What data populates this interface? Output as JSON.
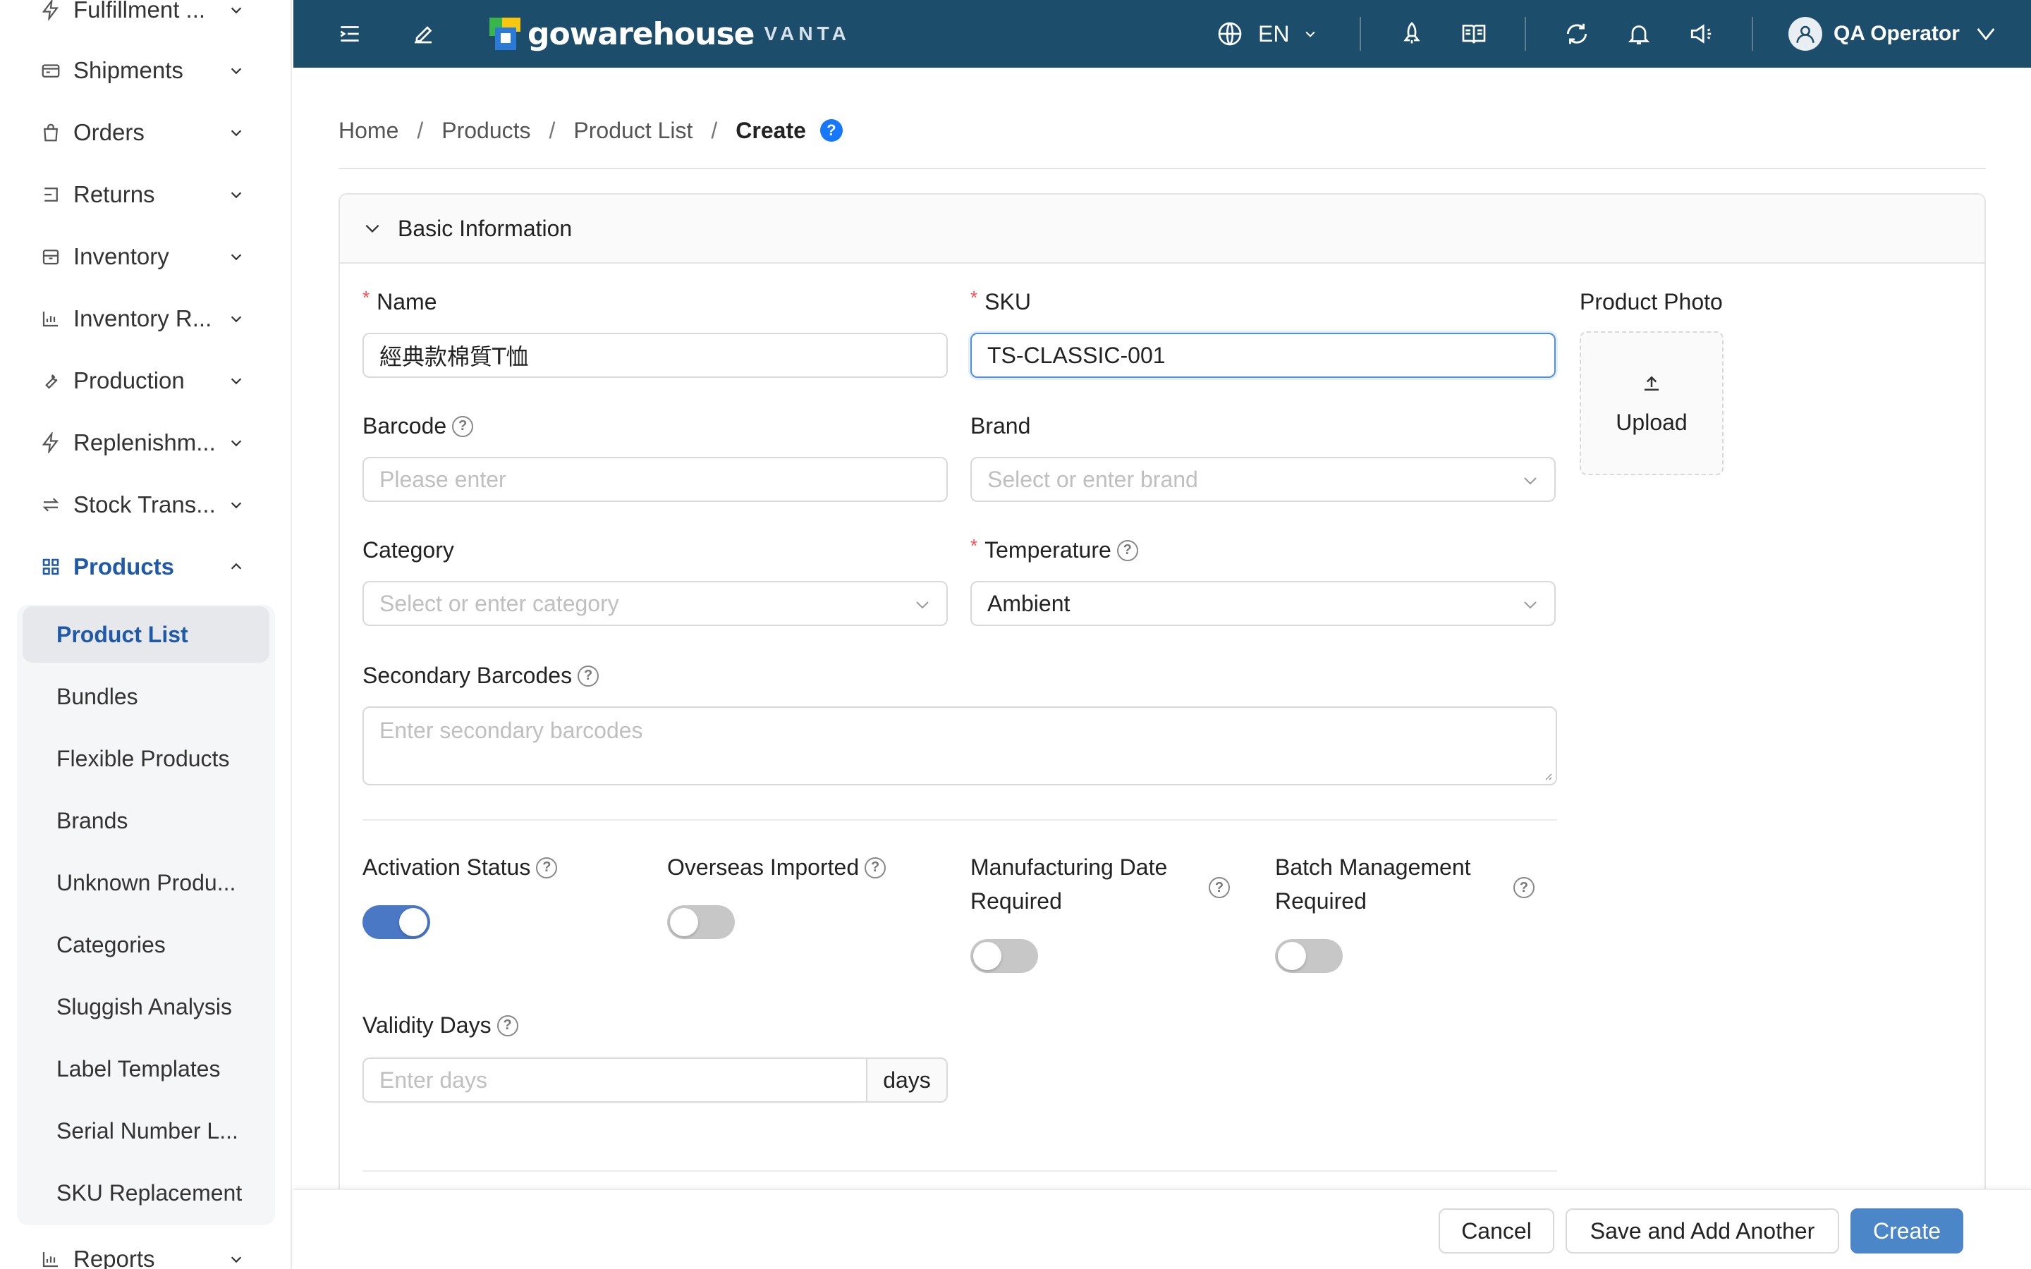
{
  "sidebar": {
    "items": [
      {
        "label": "Fulfillment ...",
        "icon": "bolt-icon"
      },
      {
        "label": "Shipments",
        "icon": "truck-icon"
      },
      {
        "label": "Orders",
        "icon": "bag-icon"
      },
      {
        "label": "Returns",
        "icon": "return-icon"
      },
      {
        "label": "Inventory",
        "icon": "box-icon"
      },
      {
        "label": "Inventory R...",
        "icon": "bar-chart-icon"
      },
      {
        "label": "Production",
        "icon": "wrench-icon"
      },
      {
        "label": "Replenishm...",
        "icon": "bolt-icon"
      },
      {
        "label": "Stock Trans...",
        "icon": "transfer-icon"
      },
      {
        "label": "Products",
        "icon": "grid-icon"
      },
      {
        "label": "Reports",
        "icon": "bar-chart-icon"
      }
    ],
    "submenu": [
      "Product List",
      "Bundles",
      "Flexible Products",
      "Brands",
      "Unknown Produ...",
      "Categories",
      "Sluggish Analysis",
      "Label Templates",
      "Serial Number L...",
      "SKU Replacement"
    ]
  },
  "header": {
    "brand": "gowarehouse",
    "brand_sub": "VANTA",
    "lang": "EN",
    "user": "QA Operator",
    "colors": {
      "bar": "#1c4d6b"
    }
  },
  "breadcrumb": {
    "items": [
      "Home",
      "Products",
      "Product List"
    ],
    "current": "Create",
    "help": "?"
  },
  "section": {
    "title": "Basic Information"
  },
  "form": {
    "name": {
      "label": "Name",
      "value": "經典款棉質T恤"
    },
    "sku": {
      "label": "SKU",
      "value": "TS-CLASSIC-001"
    },
    "photo": {
      "label": "Product Photo",
      "upload": "Upload"
    },
    "barcode": {
      "label": "Barcode",
      "placeholder": "Please enter"
    },
    "brand": {
      "label": "Brand",
      "placeholder": "Select or enter brand"
    },
    "category": {
      "label": "Category",
      "placeholder": "Select or enter category"
    },
    "temperature": {
      "label": "Temperature",
      "value": "Ambient"
    },
    "secondary": {
      "label": "Secondary Barcodes",
      "placeholder": "Enter secondary barcodes"
    },
    "activation": {
      "label": "Activation Status",
      "on": true
    },
    "overseas": {
      "label": "Overseas Imported",
      "on": false
    },
    "mfg": {
      "label1": "Manufacturing Date",
      "label2": "Required",
      "on": false
    },
    "batch": {
      "label1": "Batch Management",
      "label2": "Required",
      "on": false
    },
    "validity": {
      "label": "Validity Days",
      "placeholder": "Enter days",
      "unit": "days"
    }
  },
  "footer": {
    "cancel": "Cancel",
    "save_add": "Save and Add Another",
    "create": "Create"
  }
}
